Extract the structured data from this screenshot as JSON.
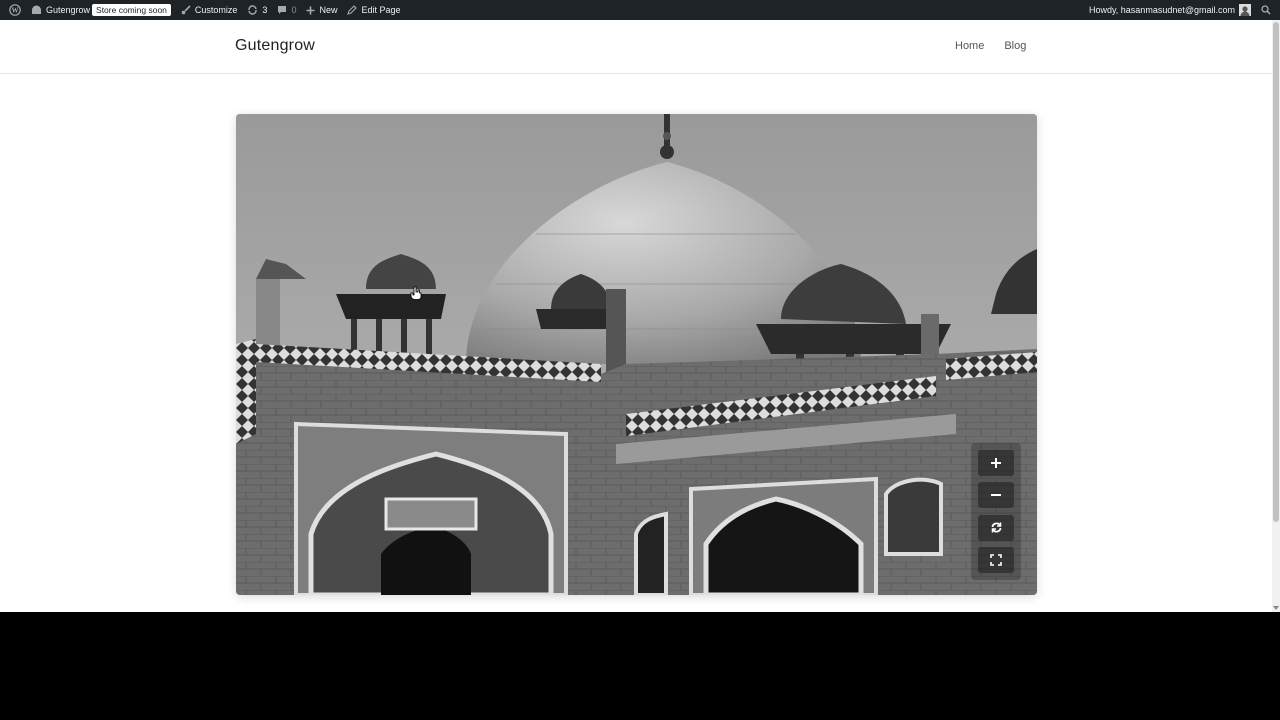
{
  "adminbar": {
    "site_name": "Gutengrow",
    "badge": "Store coming soon",
    "customize": "Customize",
    "updates_count": "3",
    "comments_count": "0",
    "new_label": "New",
    "edit_label": "Edit Page",
    "howdy": "Howdy, hasanmasudnet@gmail.com"
  },
  "site": {
    "title": "Gutengrow",
    "nav": [
      "Home",
      "Blog"
    ]
  },
  "viewer": {
    "controls": [
      "+",
      "−",
      "⟳",
      "⛶"
    ]
  },
  "colors": {
    "adminbar_bg": "#1d2327",
    "page_bg": "#ffffff"
  }
}
